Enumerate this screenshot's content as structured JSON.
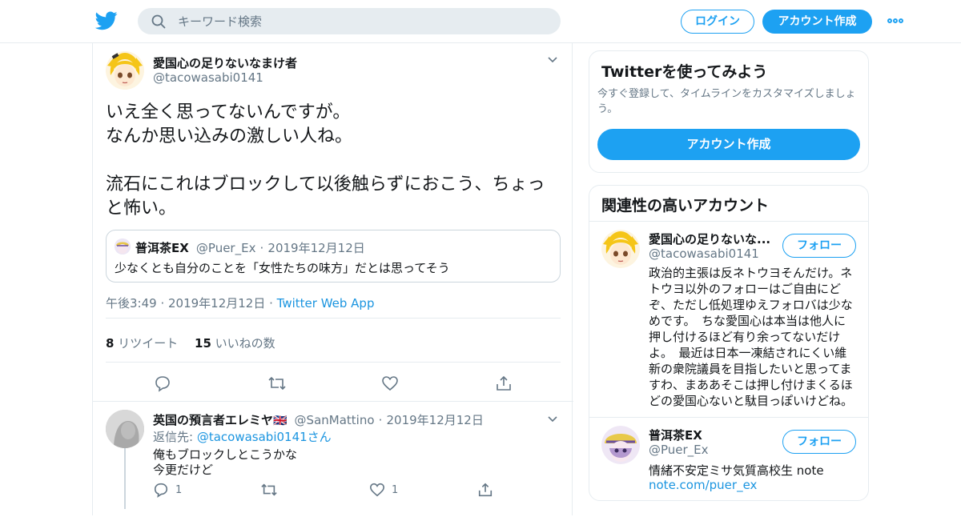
{
  "header": {
    "search_placeholder": "キーワード検索",
    "login_label": "ログイン",
    "signup_label": "アカウント作成",
    "brand_color": "#1da1f2"
  },
  "tweet": {
    "author_name": "愛国心の足りないなまけ者",
    "author_handle": "@tacowasabi0141",
    "text": "いえ全く思ってないんですが。\nなんか思い込みの激しい人ね。\n\n流石にこれはブロックして以後触らずにおこう、ちょっと怖い。",
    "quote": {
      "name": "普洱茶EX",
      "handle": "@Puer_Ex",
      "dot": "·",
      "date": "2019年12月12日",
      "text": "少なくとも自分のことを「女性たちの味方」だとは思ってそう"
    },
    "time": "午後3:49 · 2019年12月12日 · ",
    "source": "Twitter Web App",
    "retweet_count": "8",
    "retweet_label": "リツイート",
    "like_count": "15",
    "like_label": "いいねの数"
  },
  "reply": {
    "name": "英国の預言者エレミヤ",
    "flag": "🇬🇧",
    "handle": "@SanMattino",
    "dot": "·",
    "date": "2019年12月12日",
    "reply_to_prefix": "返信先: ",
    "reply_to_handle": "@tacowasabi0141",
    "reply_to_suffix": "さん",
    "text_line1": "俺もブロックしとこうかな",
    "text_line2": "今更だけど",
    "reply_count": "1",
    "like_count": "1"
  },
  "sidebar": {
    "signup_card": {
      "title": "Twitterを使ってみよう",
      "description": "今すぐ登録して、タイムラインをカスタマイズしましょう。",
      "button_label": "アカウント作成"
    },
    "related": {
      "title": "関連性の高いアカウント",
      "follow_label": "フォロー",
      "accounts": [
        {
          "name": "愛国心の足りないな...",
          "handle": "@tacowasabi0141",
          "bio": "政治的主張は反ネトウヨそんだけ。ネトウヨ以外のフォローはご自由にどぞ、ただし低処理ゆえフォロバは少なめです。　ちな愛国心は本当は他人に押し付けるほど有り余ってないだけよ。　最近は日本一凍結されにくい維新の衆院議員を目指したいと思ってますわ、まああそこは押し付けまくるほどの愛国心ないと駄目っぽいけどね。"
        },
        {
          "name": "普洱茶EX",
          "handle": "@Puer_Ex",
          "bio": "情緒不安定ミサ気質高校生 note",
          "link": "note.com/puer_ex"
        }
      ]
    }
  }
}
